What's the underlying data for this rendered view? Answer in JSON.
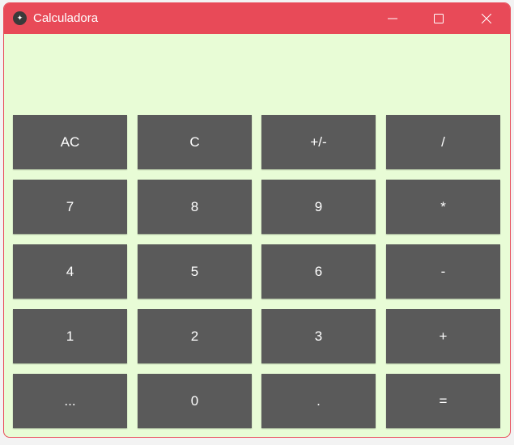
{
  "window": {
    "title": "Calculadora",
    "accent": "#e84a58",
    "background": "#e8fcd6"
  },
  "display": {
    "value": ""
  },
  "buttons": [
    [
      "AC",
      "C",
      "+/-",
      "/"
    ],
    [
      "7",
      "8",
      "9",
      "*"
    ],
    [
      "4",
      "5",
      "6",
      "-"
    ],
    [
      "1",
      "2",
      "3",
      "+"
    ],
    [
      "...",
      "0",
      ".",
      "="
    ]
  ]
}
